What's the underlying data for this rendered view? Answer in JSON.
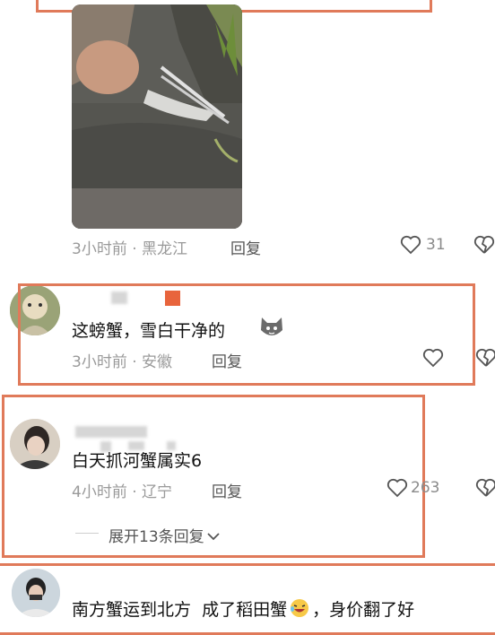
{
  "comments": [
    {
      "meta": "3小时前 · 黑龙江",
      "reply": "回复",
      "likes": "31"
    },
    {
      "text": "这螃蟹，雪白干净的",
      "meta": "3小时前 · 安徽",
      "reply": "回复",
      "likes": ""
    },
    {
      "text": "白天抓河蟹属实6",
      "meta": "4小时前 · 辽宁",
      "reply": "回复",
      "likes": "263",
      "expand": "展开13条回复"
    },
    {
      "text": "南方蟹运到北方  成了稻田蟹",
      "text_tail": "，身价翻了好"
    }
  ],
  "colors": {
    "highlight": "#e07a5a",
    "accent_square": "#e8643c"
  },
  "icons": [
    "heart-icon",
    "broken-heart-icon",
    "chevron-down-icon",
    "cat-emoji-icon",
    "laughing-emoji-icon"
  ]
}
